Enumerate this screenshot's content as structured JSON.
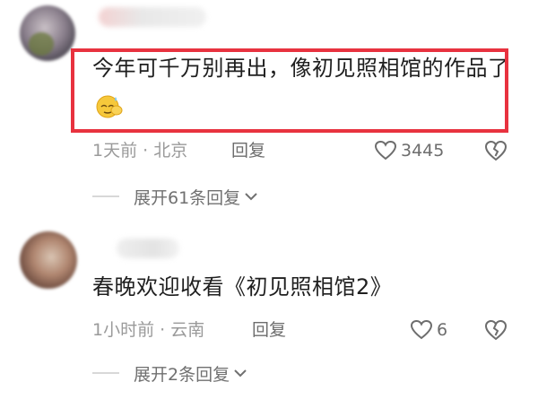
{
  "comments": [
    {
      "text": "今年可千万别再出，像初见照相馆的作品了",
      "emoji": "sweat-face-hand-emoji",
      "time_location": "1天前 · 北京",
      "reply_label": "回复",
      "likes": "3445",
      "expand_label": "展开61条回复",
      "highlighted": true
    },
    {
      "text": "春晚欢迎收看《初见照相馆2》",
      "time_location": "1小时前 · 云南",
      "reply_label": "回复",
      "likes": "6",
      "expand_label": "展开2条回复",
      "highlighted": false
    }
  ],
  "colors": {
    "highlight_border": "#e8323f",
    "meta_text": "#9a9a9a",
    "body_text": "#1f1f1f"
  },
  "icons": [
    "heart-outline-icon",
    "broken-heart-outline-icon",
    "chevron-down-icon"
  ]
}
